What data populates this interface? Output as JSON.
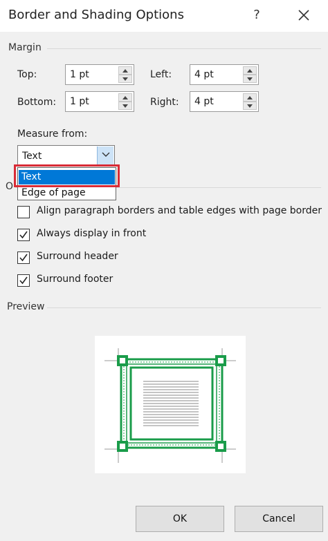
{
  "dialog": {
    "title": "Border and Shading Options",
    "help_label": "?"
  },
  "margin": {
    "section_label": "Margin",
    "top_label": "Top:",
    "top_value": "1 pt",
    "left_label": "Left:",
    "left_value": "4 pt",
    "bottom_label": "Bottom:",
    "bottom_value": "1 pt",
    "right_label": "Right:",
    "right_value": "4 pt",
    "measure_label": "Measure from:",
    "measure_value": "Text",
    "measure_options": [
      "Text",
      "Edge of page"
    ]
  },
  "options": {
    "section_label": "O",
    "align_label": "Align paragraph borders and table edges with page border",
    "align_checked": false,
    "front_label": "Always display in front",
    "front_checked": true,
    "header_label": "Surround header",
    "header_checked": true,
    "footer_label": "Surround footer",
    "footer_checked": true
  },
  "preview": {
    "section_label": "Preview",
    "border_color": "#1a9c4a"
  },
  "buttons": {
    "ok_label": "OK",
    "cancel_label": "Cancel"
  },
  "colors": {
    "dropdown_selected": "#0078d7",
    "highlight_box": "#d92b36"
  }
}
